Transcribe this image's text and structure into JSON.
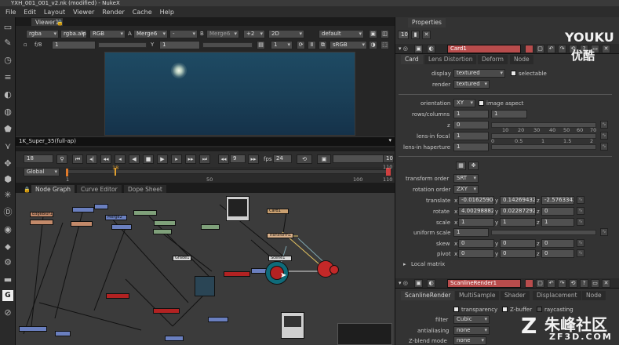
{
  "window": {
    "title": "YXH_001_001_v2.nk (modified) - NukeX"
  },
  "menu": [
    "File",
    "Edit",
    "Layout",
    "Viewer",
    "Render",
    "Cache",
    "Help"
  ],
  "tools": [
    "picture-icon",
    "draw-icon",
    "time-icon",
    "channel-icon",
    "color-icon",
    "filter-icon",
    "keyer-icon",
    "merge-icon",
    "transform-icon",
    "3d-icon",
    "particles-icon",
    "deep-icon",
    "views-icon",
    "metadata-icon",
    "toolsets-icon",
    "other-icon",
    "gizmo-icon",
    "settings-icon"
  ],
  "viewer": {
    "tab": "Viewer1",
    "row1": {
      "channels": "rgba",
      "alpha": "rgba.alp",
      "display": "RGB",
      "a_label": "A",
      "a_input": "Merge6",
      "minus": "-",
      "b_label": "B",
      "b_input": "Merge6",
      "plus": "+2",
      "mode": "2D",
      "lut": "default"
    },
    "row2": {
      "fstop": "f/8",
      "gain": "1",
      "y_label": "Y",
      "gamma": "1",
      "proxy": "1",
      "colorspace": "sRGB"
    },
    "format": "1K_Super_35(full-ap)",
    "transport": {
      "frame": "18",
      "current": "9",
      "fps_label": "fps",
      "fps": "24",
      "step": "10"
    },
    "timeline": {
      "scope": "Global",
      "start": "1",
      "marker": "18",
      "mid": "50",
      "t100": "100",
      "end": "110",
      "end_top": "110"
    }
  },
  "graph": {
    "tabs": [
      "Node Graph",
      "Curve Editor",
      "Dope Sheet"
    ],
    "nodes": [
      "EdgeBlur1",
      "Merge2",
      "Card1",
      "Transform1",
      "Grade1",
      "Read3",
      "Merge6",
      "ScanlineRender1",
      "Camera1",
      "Scene1",
      "Read4",
      "Blur2"
    ]
  },
  "properties": {
    "title": "Properties",
    "max_panels": "10",
    "card": {
      "name": "Card1",
      "tabs": [
        "Card",
        "Lens Distortion",
        "Deform",
        "Node"
      ],
      "display_label": "display",
      "display": "textured",
      "selectable": "selectable",
      "render_label": "render",
      "render": "textured",
      "orientation_label": "orientation",
      "orientation": "XY",
      "image_aspect": "image aspect",
      "rows_label": "rows/columns",
      "rows": "1",
      "cols": "1",
      "z_label": "z",
      "z": "0",
      "lens_focal_label": "lens-in focal",
      "lens_focal": "1",
      "lens_haperture_label": "lens-in haperture",
      "lens_haperture": "1",
      "slider_ticks_a": [
        "10",
        "20",
        "30",
        "40",
        "50",
        "60",
        "70"
      ],
      "slider_ticks_b": [
        "0",
        "0.5",
        "1",
        "1.5",
        "2"
      ],
      "transform_order_label": "transform order",
      "transform_order": "SRT",
      "rotation_order_label": "rotation order",
      "rotation_order": "ZXY",
      "translate_label": "translate",
      "translate": {
        "x": "-0.01625904",
        "y": "0.14269432",
        "z": "-2.5763342"
      },
      "rotate_label": "rotate",
      "rotate": {
        "x": "4.00298882",
        "y": "0.02287292",
        "z": "0"
      },
      "scale_label": "scale",
      "scale": {
        "x": "1",
        "y": "1",
        "z": "1"
      },
      "uniform_scale_label": "uniform scale",
      "uniform_scale": "1",
      "skew_label": "skew",
      "skew": {
        "x": "0",
        "y": "0",
        "z": "0"
      },
      "pivot_label": "pivot",
      "pivot": {
        "x": "0",
        "y": "0",
        "z": "0"
      },
      "local_matrix": "Local matrix",
      "axis": {
        "x": "x",
        "y": "y",
        "z": "z"
      }
    },
    "scanline": {
      "name": "ScanlineRender1",
      "tabs": [
        "ScanlineRender",
        "MultiSample",
        "Shader",
        "Displacement",
        "Node"
      ],
      "transparency": "transparency",
      "zbuffer": "Z-buffer",
      "raycasting": "raycasting",
      "filter_label": "filter",
      "filter": "Cubic",
      "antialiasing_label": "antialiasing",
      "antialiasing": "none",
      "zblend_label": "Z-blend mode",
      "zblend": "none"
    }
  },
  "watermarks": {
    "youku": "YOUKU",
    "youku_cn": "优酷",
    "site_cn": "朱峰社区",
    "site_en": "ZF3D.COM"
  },
  "colors": {
    "accent_red": "#b84c4c",
    "node_red": "#b22222",
    "sky": "#1e4a63"
  }
}
